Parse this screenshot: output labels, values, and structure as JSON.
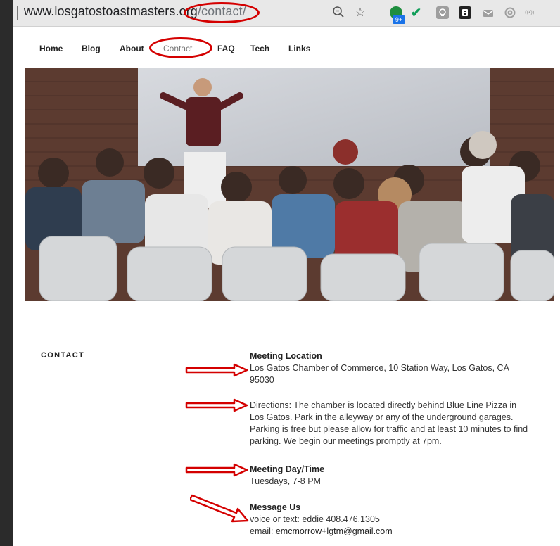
{
  "browser": {
    "url_domain": "www.losgatostoastmasters.org",
    "url_path": "/contact/",
    "zoom_icon": "zoom-icon",
    "bookmark_icon": "star-icon",
    "extension_badge": "9+"
  },
  "nav": {
    "items": [
      "Home",
      "Blog",
      "About",
      "Contact",
      "FAQ",
      "Tech",
      "Links"
    ],
    "active": "Contact"
  },
  "contact": {
    "section_title": "CONTACT",
    "meeting_location_heading": "Meeting Location",
    "meeting_location_text": "Los Gatos Chamber of Commerce, 10 Station Way, Los Gatos, CA 95030",
    "directions_text": "Directions: The chamber is located directly behind Blue Line Pizza in Los Gatos. Park in the alleyway or any of the underground garages. Parking is free but please allow for traffic and at least 10 minutes to find parking. We begin our meetings promptly at 7pm.",
    "meeting_time_heading": "Meeting Day/Time",
    "meeting_time_text": "Tuesdays, 7-8 PM",
    "message_heading": "Message Us",
    "message_phone": "voice or text: eddie 408.476.1305",
    "message_email_prefix": "email: ",
    "message_email": "emcmorrow+lgtm@gmail.com"
  },
  "colors": {
    "annotation_red": "#d40000",
    "page_bg": "#ffffff",
    "frame_bg": "#2b2b2b"
  }
}
